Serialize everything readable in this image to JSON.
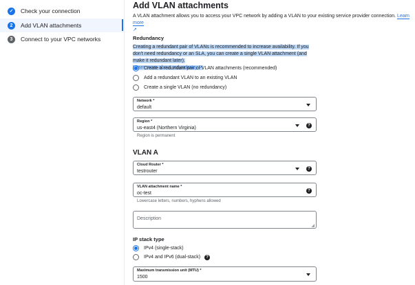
{
  "steps": [
    {
      "label": "Check your connection",
      "num": "✓"
    },
    {
      "label": "Add VLAN attachments",
      "num": "2"
    },
    {
      "label": "Connect to your VPC networks",
      "num": "3"
    }
  ],
  "title": "Add VLAN attachments",
  "description": "A VLAN attachment allows you to access your VPC network by adding a VLAN to your existing service provider connection.",
  "learn_more": "Learn more",
  "redundancy": {
    "heading": "Redundancy",
    "text": "Creating a redundant pair of VLANs is recommended to increase availability. If you don't need redundancy or an SLA, you can create a single VLAN attachment (and make it redundant later).",
    "link": "Learn more about redundancy",
    "options": [
      "Create a redundant pair of VLAN attachments (recommended)",
      "Add a redundant VLAN to an existing VLAN",
      "Create a single VLAN (no redundancy)"
    ],
    "selected": 0
  },
  "network": {
    "label": "Network *",
    "value": "default"
  },
  "region": {
    "label": "Region *",
    "value": "us-east4 (Northern Virginia)",
    "hint": "Region is permanent"
  },
  "vlan_a": "VLAN A",
  "router": {
    "label": "Cloud Router *",
    "value": "testrouter"
  },
  "vlan_name": {
    "label": "VLAN attachment name *",
    "value": "oc-test",
    "hint": "Lowercase letters, numbers, hyphens allowed"
  },
  "desc_field": {
    "placeholder": "Description"
  },
  "ip_stack": {
    "heading": "IP stack type",
    "options": [
      "IPv4 (single-stack)",
      "IPv4 and IPv6 (dual-stack)"
    ],
    "selected": 0
  },
  "mtu": {
    "label": "Maximum transmission unit (MTU) *",
    "value": "1500"
  }
}
